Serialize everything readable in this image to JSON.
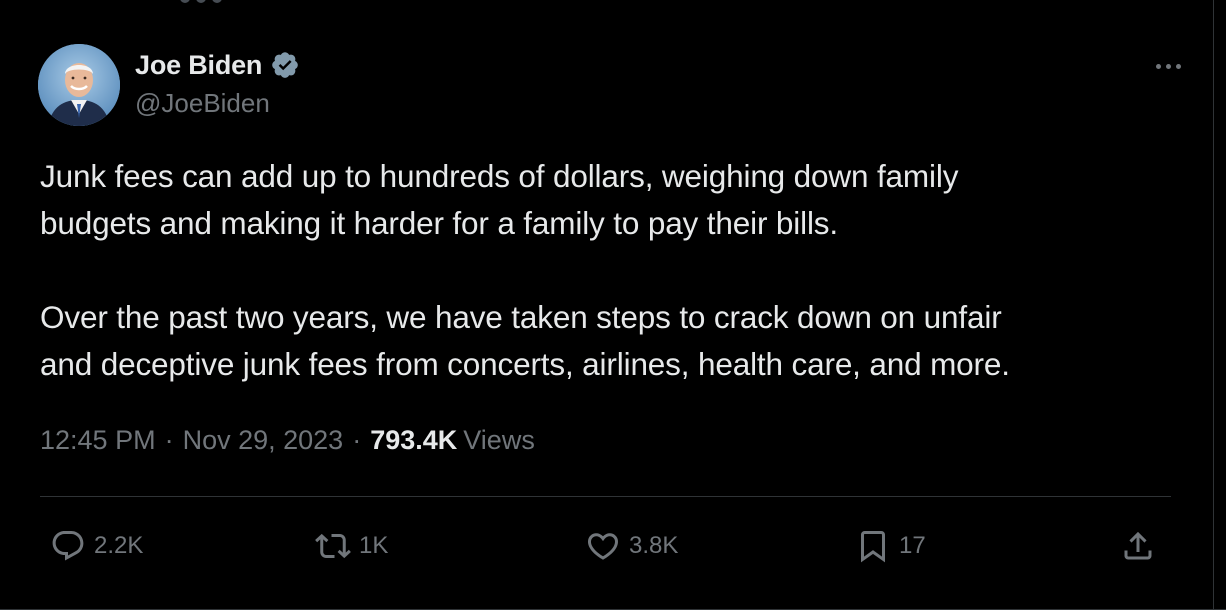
{
  "tweet": {
    "author": {
      "display_name": "Joe Biden",
      "handle": "@JoeBiden",
      "avatar_icon": "profile-photo",
      "verified_icon": "verified-badge-icon"
    },
    "text": "Junk fees can add up to hundreds of dollars, weighing down family\nbudgets and making it harder for a family to pay their bills.\n\nOver the past two years, we have taken steps to crack down on unfair\nand deceptive junk fees from concerts, airlines, health care, and more.",
    "time": "12:45 PM",
    "separator": "·",
    "date": "Nov 29, 2023",
    "views_count": "793.4K",
    "views_label": "Views",
    "actions": {
      "replies": "2.2K",
      "reposts": "1K",
      "likes": "3.8K",
      "bookmarks": "17"
    }
  },
  "colors": {
    "background": "#000000",
    "text_primary": "#e7e9ea",
    "text_secondary": "#71767b",
    "divider": "#2f3336",
    "verified": "#829aab"
  }
}
